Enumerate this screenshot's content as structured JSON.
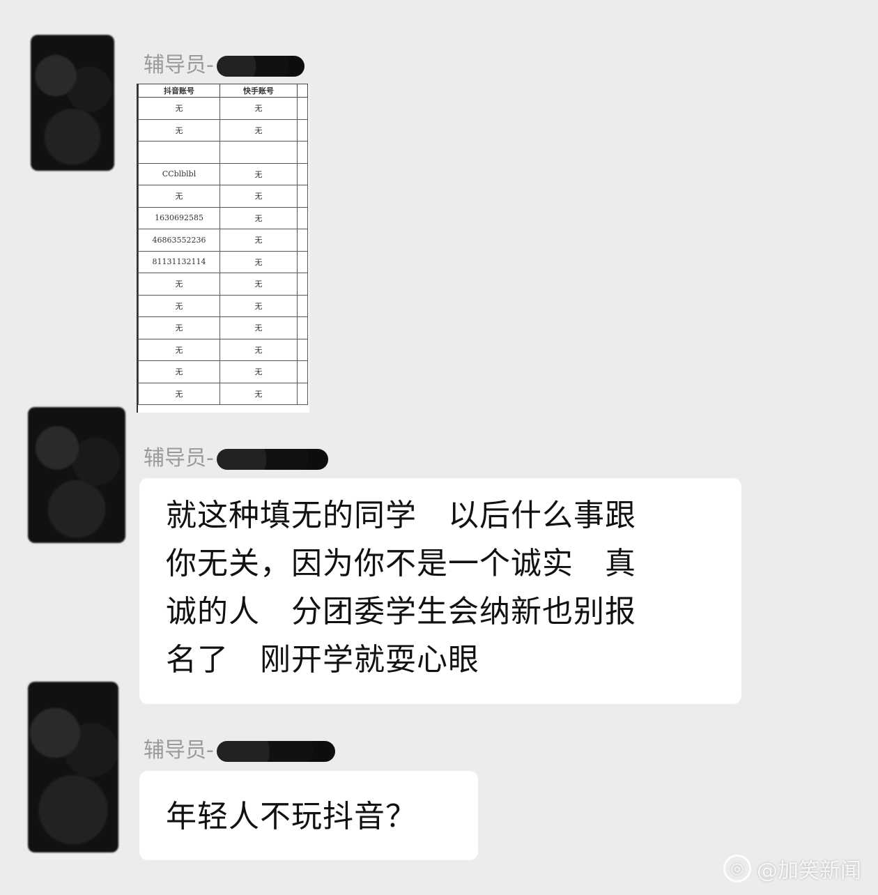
{
  "messages": [
    {
      "sender": "辅导员-",
      "type": "image",
      "spreadsheet": {
        "columns": [
          "抖音账号",
          "快手账号"
        ],
        "rows": [
          [
            "无",
            "无"
          ],
          [
            "无",
            "无"
          ],
          [
            "",
            ""
          ],
          [
            "CCblblbl",
            "无"
          ],
          [
            "无",
            "无"
          ],
          [
            "1630692585",
            "无"
          ],
          [
            "46863552236",
            "无"
          ],
          [
            "81131132114",
            "无"
          ],
          [
            "无",
            "无"
          ],
          [
            "无",
            "无"
          ],
          [
            "无",
            "无"
          ],
          [
            "无",
            "无"
          ],
          [
            "无",
            "无"
          ],
          [
            "无",
            "无"
          ]
        ]
      }
    },
    {
      "sender": "辅导员-",
      "type": "text",
      "lines": [
        "就这种填无的同学   以后什么事跟",
        "你无关，因为你不是一个诚实   真",
        "诚的人   分团委学生会纳新也别报",
        "名了   刚开学就耍心眼"
      ]
    },
    {
      "sender": "辅导员-",
      "type": "text",
      "lines": [
        "年轻人不玩抖音？"
      ]
    }
  ],
  "watermark": {
    "icon": "weibo-logo-icon",
    "text": "@加笑新闻"
  }
}
